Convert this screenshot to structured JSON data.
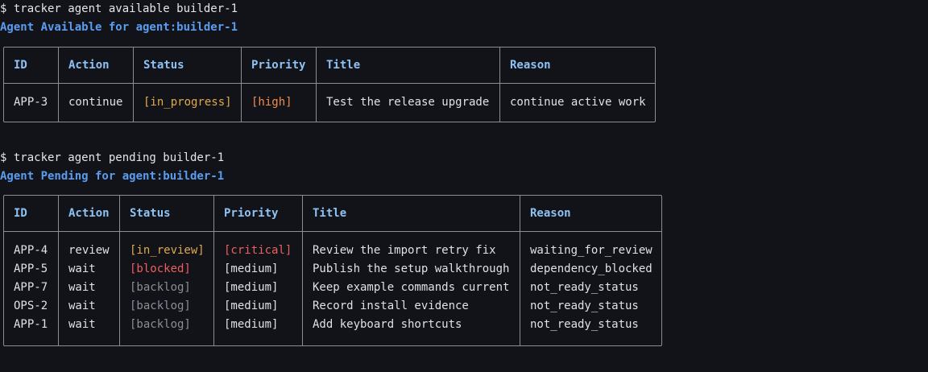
{
  "colors": {
    "background": "#121318",
    "heading": "#5a9cf0",
    "column_header": "#8ec2f5",
    "in_progress": "#e0a94a",
    "in_review": "#e0a94a",
    "blocked": "#ec5f5f",
    "backlog": "#8a8e99",
    "high": "#ef8c4c",
    "critical": "#ec5f5f",
    "border": "#8a8e99"
  },
  "available": {
    "command": "$ tracker agent available builder-1",
    "heading": "Agent Available for agent:builder-1",
    "columns": [
      "ID",
      "Action",
      "Status",
      "Priority",
      "Title",
      "Reason"
    ],
    "rows": [
      {
        "id": "APP-3",
        "action": "continue",
        "status": "[in_progress]",
        "priority": "[high]",
        "title": "Test the release upgrade",
        "reason": "continue active work"
      }
    ]
  },
  "pending": {
    "command": "$ tracker agent pending builder-1",
    "heading": "Agent Pending for agent:builder-1",
    "columns": [
      "ID",
      "Action",
      "Status",
      "Priority",
      "Title",
      "Reason"
    ],
    "rows": [
      {
        "id": "APP-4",
        "action": "review",
        "status": "[in_review]",
        "priority": "[critical]",
        "title": "Review the import retry fix",
        "reason": "waiting_for_review"
      },
      {
        "id": "APP-5",
        "action": "wait",
        "status": "[blocked]",
        "priority": "[medium]",
        "title": "Publish the setup walkthrough",
        "reason": "dependency_blocked"
      },
      {
        "id": "APP-7",
        "action": "wait",
        "status": "[backlog]",
        "priority": "[medium]",
        "title": "Keep example commands current",
        "reason": "not_ready_status"
      },
      {
        "id": "OPS-2",
        "action": "wait",
        "status": "[backlog]",
        "priority": "[medium]",
        "title": "Record install evidence",
        "reason": "not_ready_status"
      },
      {
        "id": "APP-1",
        "action": "wait",
        "status": "[backlog]",
        "priority": "[medium]",
        "title": "Add keyboard shortcuts",
        "reason": "not_ready_status"
      }
    ]
  }
}
